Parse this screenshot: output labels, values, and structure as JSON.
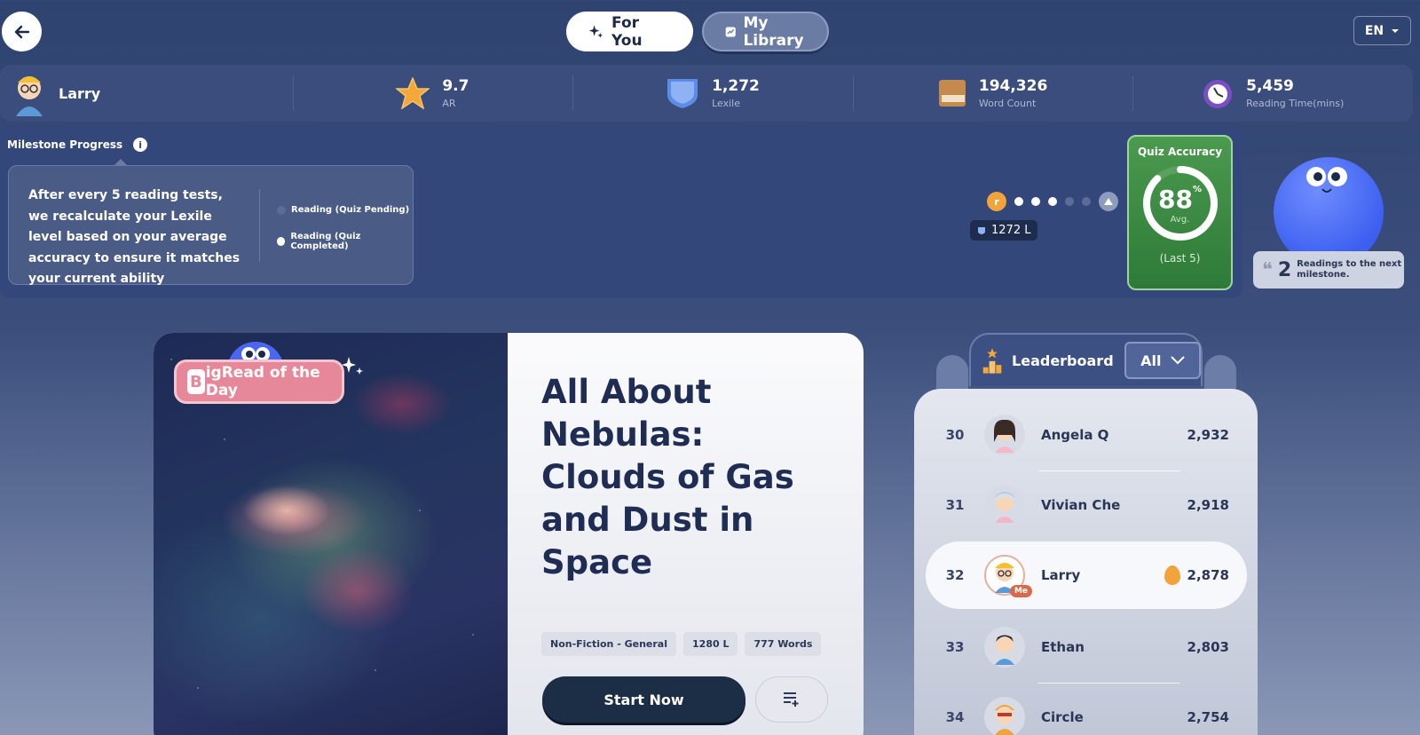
{
  "nav": {
    "tabs": [
      {
        "label": "For You"
      },
      {
        "label": "My Library"
      }
    ],
    "lang": "EN"
  },
  "stats": {
    "user": "Larry",
    "ar": {
      "value": "9.7",
      "label": "AR"
    },
    "lexile": {
      "value": "1,272",
      "label": "Lexile"
    },
    "words": {
      "value": "194,326",
      "label": "Word Count"
    },
    "time": {
      "value": "5,459",
      "label": "Reading Time(mins)"
    }
  },
  "milestone": {
    "title": "Milestone Progress",
    "info": "i",
    "tooltip": "After every 5 reading tests, we recalculate your Lexile level based on your average accuracy to ensure it matches your current ability",
    "legend": [
      "Reading (Quiz Pending)",
      "Reading (Quiz Completed)"
    ],
    "lexile_badge": "1272 L",
    "quiz": {
      "title": "Quiz Accuracy",
      "value": "88",
      "unit": "%",
      "avg": "Avg.",
      "last": "(Last 5)",
      "fraction": 0.88
    },
    "next": {
      "count": "2",
      "text": "Readings to the next milestone."
    }
  },
  "book": {
    "badge": "igRead of the Day",
    "badge_letter": "B",
    "title": "All About Nebulas: Clouds of Gas and Dust in Space",
    "tags": [
      "Non-Fiction - General",
      "1280 L",
      "777 Words"
    ],
    "start": "Start Now"
  },
  "leaderboard": {
    "title": "Leaderboard",
    "filter": "All",
    "rows": [
      {
        "rank": "30",
        "name": "Angela Q",
        "score": "2,932"
      },
      {
        "rank": "31",
        "name": "Vivian Che",
        "score": "2,918"
      },
      {
        "rank": "32",
        "name": "Larry",
        "score": "2,878",
        "me": "Me"
      },
      {
        "rank": "33",
        "name": "Ethan",
        "score": "2,803"
      },
      {
        "rank": "34",
        "name": "Circle",
        "score": "2,754"
      }
    ]
  },
  "colors": {
    "accent": "#1c2d46",
    "quiz": "#3e8b45",
    "me_tag": "#d66a4a"
  }
}
